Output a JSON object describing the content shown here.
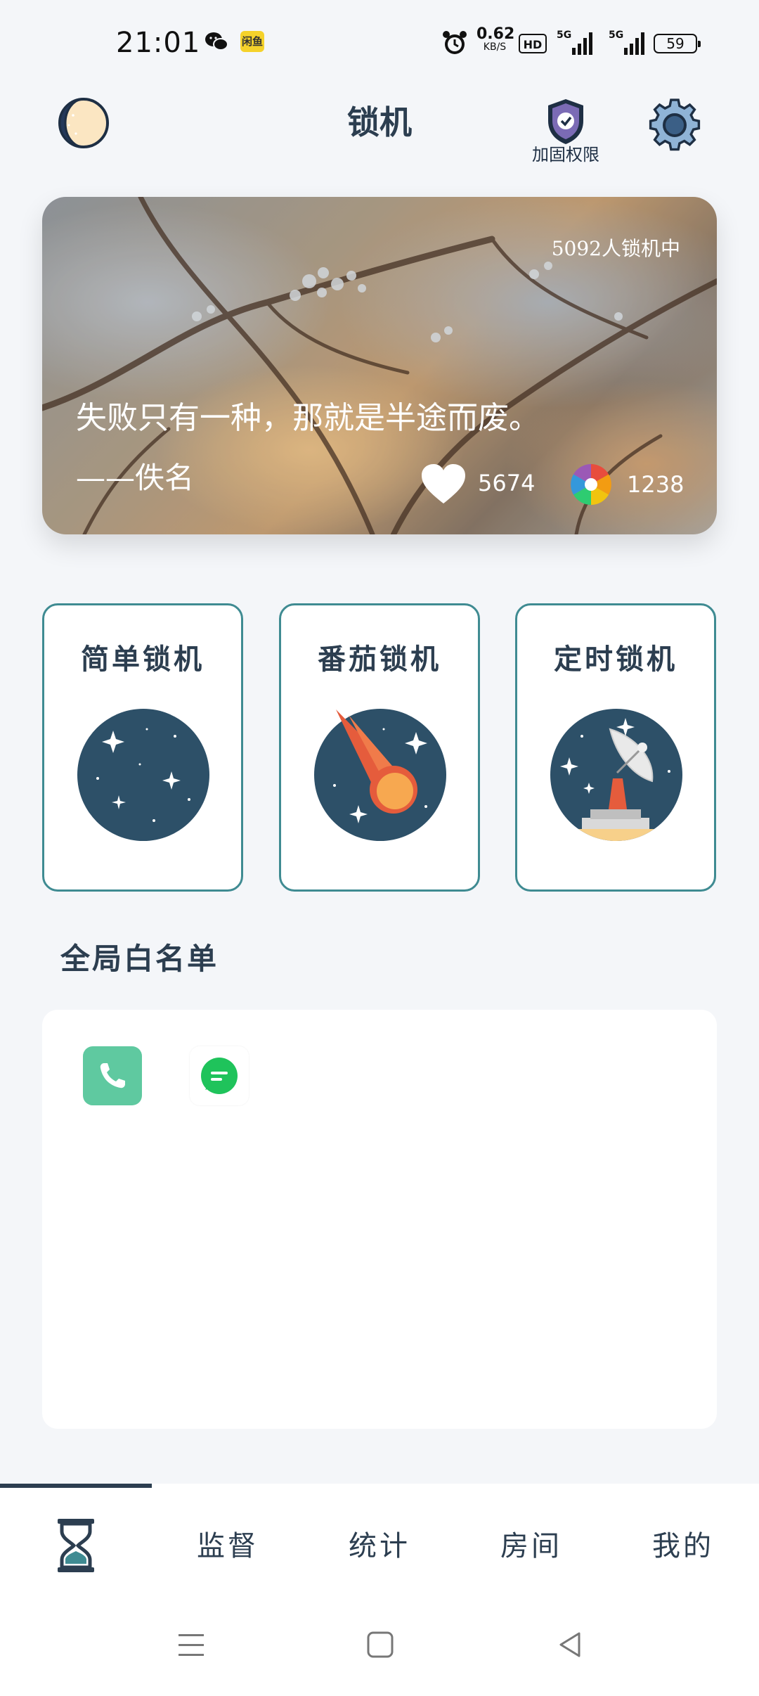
{
  "status_bar": {
    "time": "21:01",
    "app_badge": "闲鱼",
    "net_speed_value": "0.62",
    "net_speed_unit": "KB/S",
    "hd_label": "HD",
    "signal1_label": "5G",
    "signal2_label": "5G",
    "battery": "59",
    "icons": [
      "wechat-icon",
      "alarm-icon",
      "signal-icon",
      "battery-icon"
    ]
  },
  "header": {
    "title": "锁机",
    "shield_label": "加固权限",
    "icons": [
      "moon-icon",
      "shield-icon",
      "gear-icon"
    ]
  },
  "banner": {
    "online_count": "5092人锁机中",
    "quote": "失败只有一种，那就是半途而废。",
    "author": "——佚名",
    "likes": "5674",
    "shares": "1238"
  },
  "modes": [
    {
      "label": "简单锁机",
      "icon": "starry-sky-icon"
    },
    {
      "label": "番茄锁机",
      "icon": "meteor-icon"
    },
    {
      "label": "定时锁机",
      "icon": "satellite-dish-icon"
    }
  ],
  "whitelist": {
    "title": "全局白名单",
    "apps": [
      "phone-app-icon",
      "messages-app-icon"
    ]
  },
  "bottom_nav": {
    "items": [
      "监督",
      "统计",
      "房间",
      "我的"
    ],
    "active_icon": "hourglass-icon"
  },
  "system_nav": [
    "menu-icon",
    "home-icon",
    "back-icon"
  ],
  "colors": {
    "primary": "#2c3e50",
    "card_border": "#3f8b92",
    "planet": "#2d5068",
    "phone_green": "#5fc9a0",
    "sms_green": "#1fc35b"
  }
}
